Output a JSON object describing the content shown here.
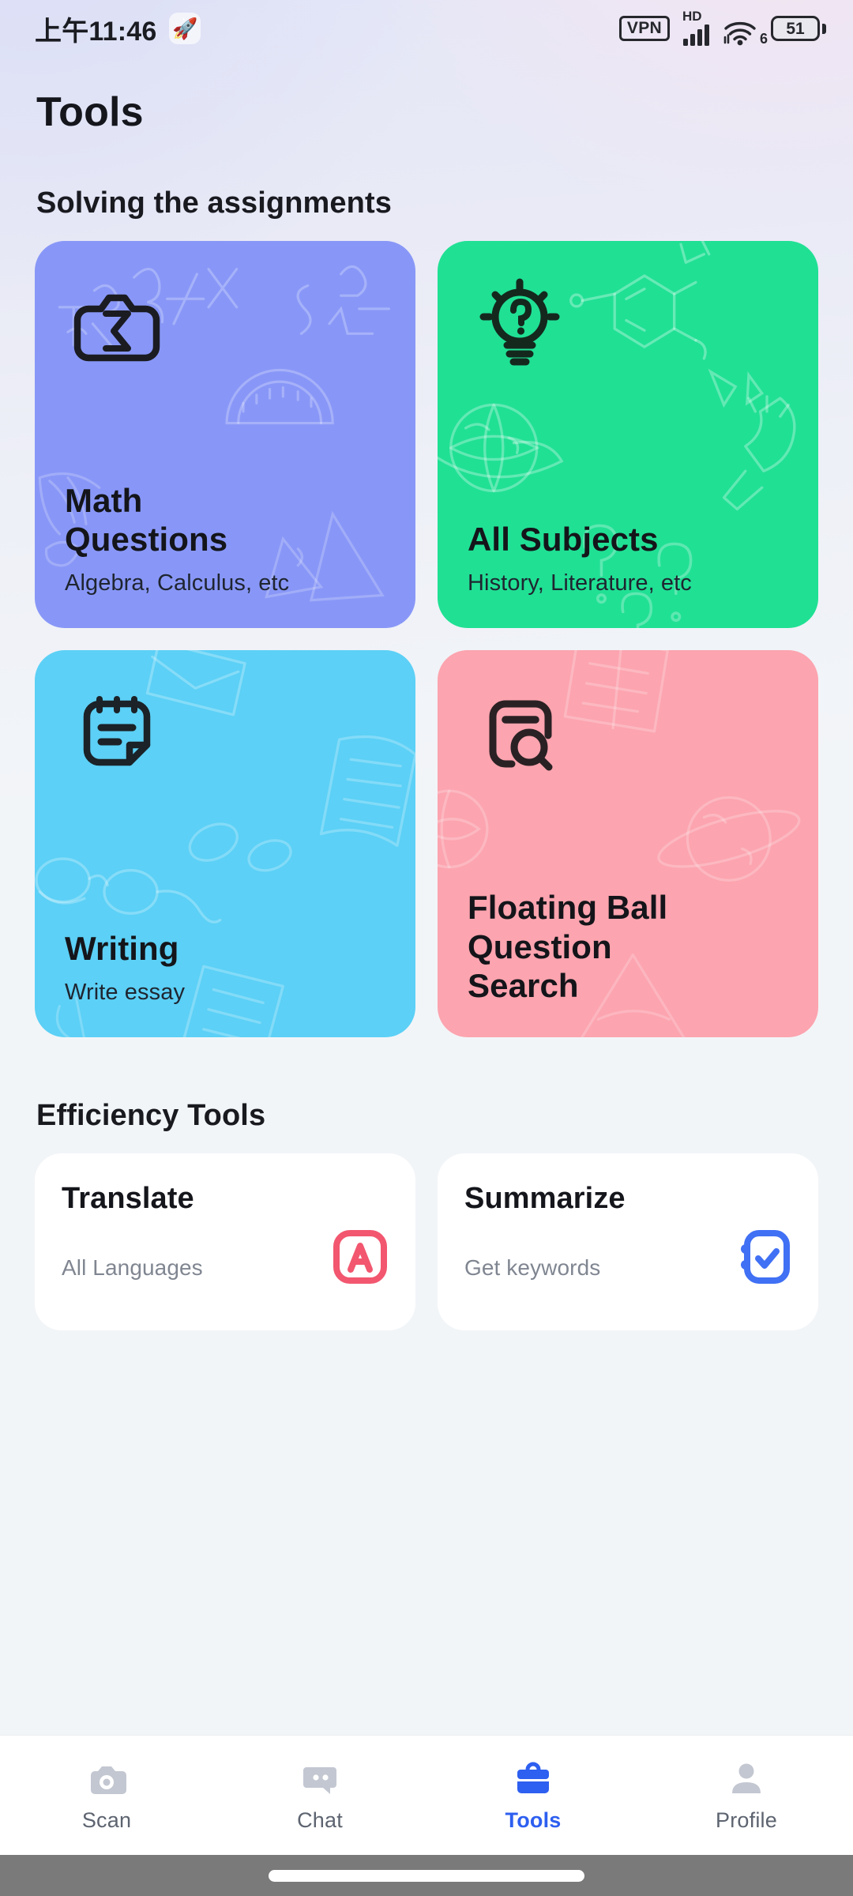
{
  "status_bar": {
    "time": "上午11:46",
    "app_icon": "rocket-icon",
    "vpn_label": "VPN",
    "network_label": "HD",
    "wifi_generation": "6",
    "battery_level": "51",
    "icons": [
      "vpn-icon",
      "signal-bars-icon",
      "wifi-icon",
      "battery-icon"
    ]
  },
  "header": {
    "title": "Tools"
  },
  "sections": [
    {
      "title": "Solving the assignments"
    },
    {
      "title": "Efficiency Tools"
    }
  ],
  "assignment_cards": [
    {
      "title": "Math Questions",
      "subtitle": "Algebra, Calculus, etc",
      "color": "#8897f7",
      "icon": "camera-sigma-icon",
      "name": "math-questions-card"
    },
    {
      "title": "All Subjects",
      "subtitle": "History, Literature, etc",
      "color": "#20e094",
      "icon": "lightbulb-question-icon",
      "name": "all-subjects-card"
    },
    {
      "title": "Writing",
      "subtitle": "Write essay",
      "color": "#5cd0f6",
      "icon": "notepad-icon",
      "name": "writing-card"
    },
    {
      "title": "Floating Ball Question Search",
      "subtitle": "",
      "color": "#fca4af",
      "icon": "document-search-icon",
      "name": "floating-ball-question-search-card"
    }
  ],
  "efficiency_cards": [
    {
      "title": "Translate",
      "subtitle": "All Languages",
      "icon": "letter-a-box-icon",
      "icon_color": "#f2576f",
      "name": "translate-card"
    },
    {
      "title": "Summarize",
      "subtitle": "Get keywords",
      "icon": "checklist-notebook-icon",
      "icon_color": "#4070f4",
      "name": "summarize-card"
    }
  ],
  "bottom_nav": {
    "active": "Tools",
    "active_color": "#2d5ff0",
    "inactive_color": "#c3c7d1",
    "items": [
      {
        "label": "Scan",
        "icon": "camera-icon"
      },
      {
        "label": "Chat",
        "icon": "chat-bubble-icon"
      },
      {
        "label": "Tools",
        "icon": "toolbox-icon"
      },
      {
        "label": "Profile",
        "icon": "person-icon"
      }
    ]
  }
}
